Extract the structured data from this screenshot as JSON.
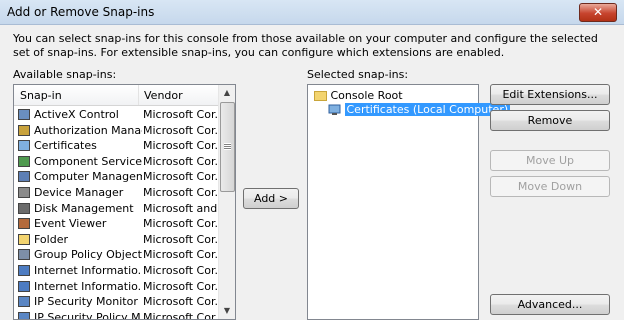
{
  "window": {
    "title": "Add or Remove Snap-ins",
    "close_label": "✕"
  },
  "description": "You can select snap-ins for this console from those available on your computer and configure the selected set of snap-ins. For extensible snap-ins, you can configure which extensions are enabled.",
  "available": {
    "label": "Available snap-ins:",
    "columns": [
      "Snap-in",
      "Vendor"
    ],
    "rows": [
      {
        "name": "ActiveX Control",
        "vendor": "Microsoft Cor...",
        "icon": "activex-icon"
      },
      {
        "name": "Authorization Manager",
        "vendor": "Microsoft Cor...",
        "icon": "authorization-manager-icon"
      },
      {
        "name": "Certificates",
        "vendor": "Microsoft Cor...",
        "icon": "certificates-icon"
      },
      {
        "name": "Component Services",
        "vendor": "Microsoft Cor...",
        "icon": "component-services-icon"
      },
      {
        "name": "Computer Managem...",
        "vendor": "Microsoft Cor...",
        "icon": "computer-management-icon"
      },
      {
        "name": "Device Manager",
        "vendor": "Microsoft Cor...",
        "icon": "device-manager-icon"
      },
      {
        "name": "Disk Management",
        "vendor": "Microsoft and...",
        "icon": "disk-management-icon"
      },
      {
        "name": "Event Viewer",
        "vendor": "Microsoft Cor...",
        "icon": "event-viewer-icon"
      },
      {
        "name": "Folder",
        "vendor": "Microsoft Cor...",
        "icon": "folder-icon"
      },
      {
        "name": "Group Policy Object ...",
        "vendor": "Microsoft Cor...",
        "icon": "group-policy-icon"
      },
      {
        "name": "Internet Informatio...",
        "vendor": "Microsoft Cor...",
        "icon": "iis-icon"
      },
      {
        "name": "Internet Informatio...",
        "vendor": "Microsoft Cor...",
        "icon": "iis-icon"
      },
      {
        "name": "IP Security Monitor",
        "vendor": "Microsoft Cor...",
        "icon": "ip-security-monitor-icon"
      },
      {
        "name": "IP Security Policy M...",
        "vendor": "Microsoft Cor...",
        "icon": "ip-security-policy-icon"
      }
    ]
  },
  "add_button": "Add >",
  "selected": {
    "label": "Selected snap-ins:",
    "root": "Console Root",
    "child": "Certificates (Local Computer)"
  },
  "buttons": {
    "edit_extensions": "Edit Extensions...",
    "remove": "Remove",
    "move_up": "Move Up",
    "move_down": "Move Down",
    "advanced": "Advanced..."
  },
  "colors": {
    "selection": "#3399ff",
    "close": "#c7442e"
  }
}
